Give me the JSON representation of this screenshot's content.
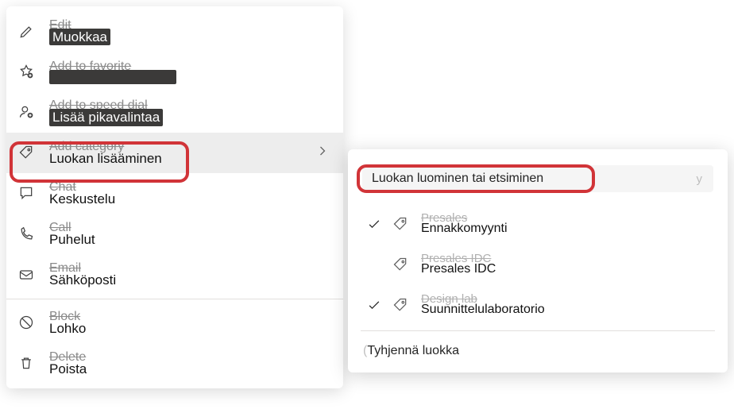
{
  "menu": {
    "items": [
      {
        "original": "Edit",
        "translated": "Muokkaa",
        "darkbg": true
      },
      {
        "original": "Add to favorite",
        "translated": "",
        "darkbg": true
      },
      {
        "original": "Add to speed dial",
        "translated": "Lisää pikavalintaa",
        "darkbg": true
      },
      {
        "original": "Add category",
        "translated": "Luokan lisääminen",
        "darkbg": false,
        "highlighted": true,
        "hasSubmenu": true
      },
      {
        "original": "Chat",
        "translated": "Keskustelu",
        "darkbg": false
      },
      {
        "original": "Call",
        "translated": "Puhelut",
        "darkbg": false
      },
      {
        "original": "Email",
        "translated": "Sähköposti",
        "darkbg": false
      },
      {
        "original": "Block",
        "translated": "Lohko",
        "darkbg": false
      },
      {
        "original": "Delete",
        "translated": "Poista",
        "darkbg": false
      }
    ]
  },
  "submenu": {
    "searchPlaceholder": "Luokan luominen tai etsiminen",
    "searchGhost": "y",
    "categories": [
      {
        "original": "Presales",
        "translated": "Ennakkomyynti",
        "checked": true
      },
      {
        "original": "Presales IDC",
        "translated": "Presales IDC",
        "checked": false
      },
      {
        "original": "Design lab",
        "translated": "Suunnittelulaboratorio",
        "checked": true
      }
    ],
    "clearPrefix": "(",
    "clearLabel": "Tyhjennä luokka"
  }
}
